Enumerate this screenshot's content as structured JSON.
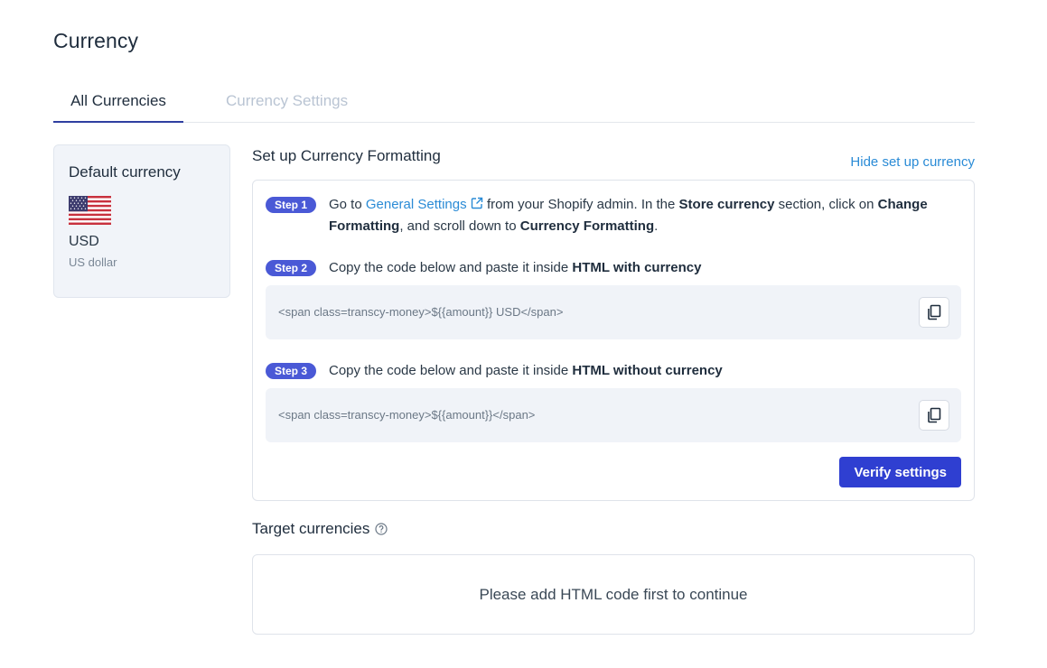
{
  "page": {
    "title": "Currency"
  },
  "tabs": [
    {
      "label": "All Currencies",
      "active": true
    },
    {
      "label": "Currency Settings",
      "active": false
    }
  ],
  "default_currency": {
    "title": "Default currency",
    "flag_icon": "us-flag-icon",
    "code": "USD",
    "name": "US dollar"
  },
  "setup": {
    "title": "Set up Currency Formatting",
    "hide_link": "Hide set up currency",
    "step1": {
      "badge": "Step 1",
      "go_to": "Go to",
      "link": "General Settings",
      "text_a": "from your Shopify admin. In the",
      "bold_a": "Store currency",
      "text_b": "section, click on",
      "bold_b": "Change Formatting",
      "text_c": ", and scroll down to",
      "bold_c": "Currency Formatting",
      "text_d": "."
    },
    "step2": {
      "badge": "Step 2",
      "text": "Copy the code below and paste it inside",
      "bold": "HTML with currency",
      "code": "<span class=transcy-money>${{amount}} USD</span>"
    },
    "step3": {
      "badge": "Step 3",
      "text": "Copy the code below and paste it inside",
      "bold": "HTML without currency",
      "code": "<span class=transcy-money>${{amount}}</span>"
    },
    "verify_button": "Verify settings"
  },
  "target": {
    "title": "Target currencies",
    "empty_message": "Please add HTML code first to continue"
  },
  "colors": {
    "accent": "#2f3fd1",
    "badge": "#4a59d6",
    "link": "#2a8bd6"
  }
}
